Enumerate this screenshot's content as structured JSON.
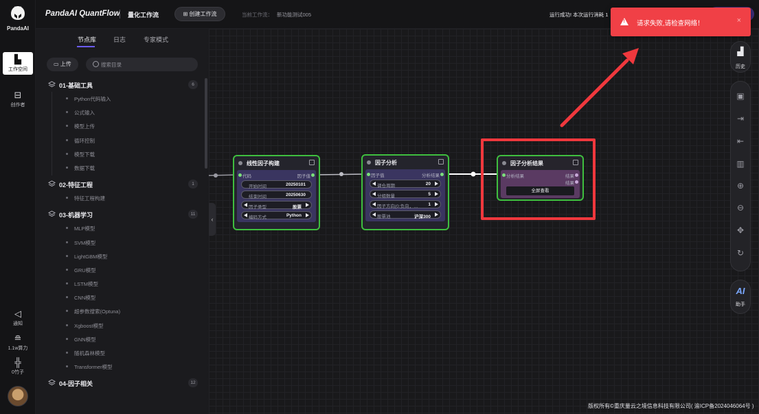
{
  "app": {
    "logo_text": "PandaAI",
    "brand": "PandaAI QuantFlow",
    "workflow_title": "量化工作流",
    "create_button": "创建工作流",
    "current_workflow_label": "当前工作流：",
    "current_workflow_name": "新功能测试005",
    "run_status": "运行成功! 本次运行消耗 1"
  },
  "rail": {
    "workspace": "工作空间",
    "creator": "创作者",
    "notify": "通知",
    "compute": "1.1w算力",
    "coins": "0竹子"
  },
  "panel": {
    "tabs": [
      "节点库",
      "日志",
      "专家模式"
    ],
    "upload": "上传",
    "search_placeholder": "搜索目录",
    "categories": [
      {
        "label": "01-基础工具",
        "count": "6",
        "items": [
          "Python代码输入",
          "公式输入",
          "模型上传",
          "循环控制",
          "模型下载",
          "数据下载"
        ]
      },
      {
        "label": "02-特征工程",
        "count": "1",
        "items": [
          "特征工程构建"
        ]
      },
      {
        "label": "03-机器学习",
        "count": "11",
        "items": [
          "MLP模型",
          "SVM模型",
          "LightGBM模型",
          "GRU模型",
          "LSTM模型",
          "CNN模型",
          "超参数搜索(Optuna)",
          "Xgboost模型",
          "GNN模型",
          "随机森林模型",
          "Transformer模型"
        ]
      },
      {
        "label": "04-因子相关",
        "count": "12",
        "items": []
      }
    ]
  },
  "nodes": {
    "factor_build": {
      "title": "线性因子构建",
      "in_label": "代码",
      "out_label": "因子值",
      "fields": [
        {
          "label": "开始时间",
          "value": "20250101"
        },
        {
          "label": "结束时间",
          "value": "20250630"
        },
        {
          "label": "因子类型",
          "value": "股票"
        },
        {
          "label": "编码方式",
          "value": "Python"
        }
      ]
    },
    "factor_analysis": {
      "title": "因子分析",
      "in_label": "因子值",
      "out_label": "分析结果",
      "fields": [
        {
          "label": "调仓周期",
          "value": "20"
        },
        {
          "label": "分组数量",
          "value": "5"
        },
        {
          "label": "因子方向(0:负向，…",
          "value": "1"
        },
        {
          "label": "股票池",
          "value": "沪深300"
        }
      ]
    },
    "factor_result": {
      "title": "因子分析结果",
      "in_label": "分析结果",
      "out_1": "结果",
      "out_2": "结果",
      "button": "全屏查看"
    }
  },
  "toast": {
    "message": "请求失败,请检查网络！",
    "close": "×"
  },
  "right_rail": {
    "history": "历史",
    "assistant_icon": "AI",
    "assistant": "助手"
  },
  "footer": "版权所有©重庆量云之境信息科技有限公司( 渝ICP备2024046064号 )",
  "colors": {
    "node_border": "#3fbf3f",
    "highlight_red": "#f0383d",
    "toast_bg": "#f04046",
    "accent": "#6b5cff"
  }
}
